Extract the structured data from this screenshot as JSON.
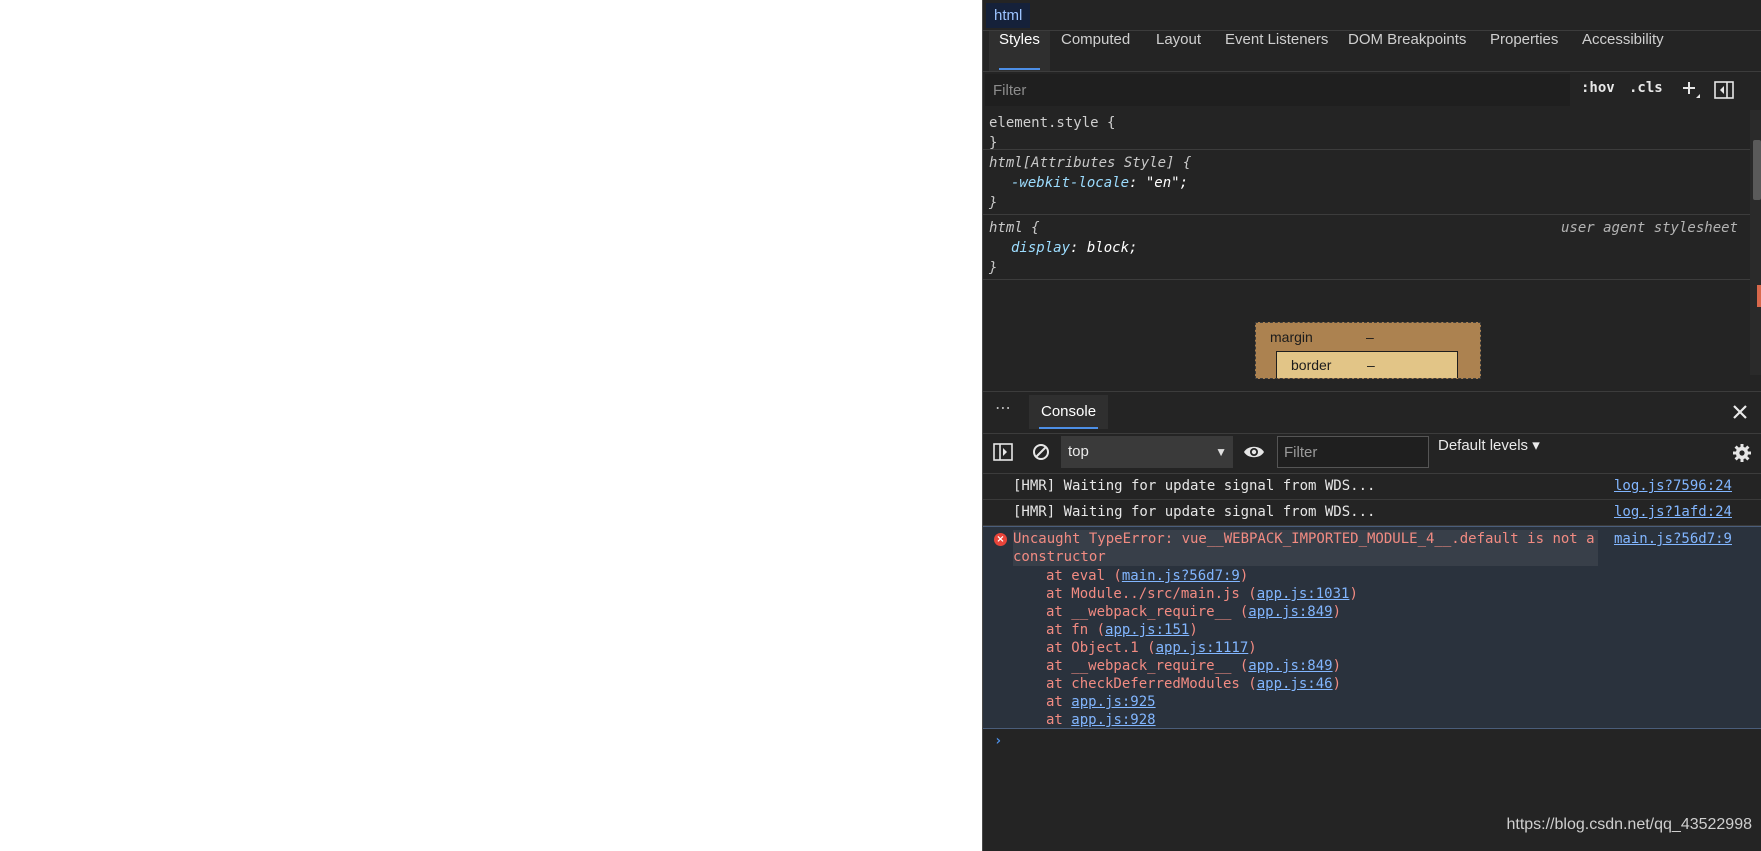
{
  "elements_panel": {
    "breadcrumb": "html",
    "tabs": [
      "Styles",
      "Computed",
      "Layout",
      "Event Listeners",
      "DOM Breakpoints",
      "Properties",
      "Accessibility"
    ],
    "filter_placeholder": "Filter",
    "hov_label": ":hov",
    "cls_label": ".cls",
    "rules": {
      "element_style": {
        "selector": "element.style {",
        "close": "}"
      },
      "attributes": {
        "selector": "html[Attributes Style] {",
        "prop": "-webkit-locale",
        "value": "\"en\"",
        "close": "}"
      },
      "ua": {
        "selector": "html {",
        "prop": "display",
        "value": "block",
        "close": "}",
        "origin": "user agent stylesheet"
      }
    },
    "box_model": {
      "margin_label": "margin",
      "margin_value": "–",
      "border_label": "border",
      "border_value": "–"
    }
  },
  "drawer": {
    "more_label": "⋮",
    "tab": "Console",
    "context": "top",
    "filter_placeholder": "Filter",
    "levels": "Default levels ▾"
  },
  "console": {
    "messages": [
      {
        "text": "[HMR] Waiting for update signal from WDS...",
        "source": "log.js?7596:24"
      },
      {
        "text": "[HMR] Waiting for update signal from WDS...",
        "source": "log.js?1afd:24"
      }
    ],
    "error": {
      "icon": "×",
      "message": "Uncaught TypeError: vue__WEBPACK_IMPORTED_MODULE_4__.default is not a constructor",
      "source": "main.js?56d7:9",
      "stack": [
        {
          "prefix": "at eval (",
          "link": "main.js?56d7:9",
          "suffix": ")"
        },
        {
          "prefix": "at Module../src/main.js (",
          "link": "app.js:1031",
          "suffix": ")"
        },
        {
          "prefix": "at __webpack_require__ (",
          "link": "app.js:849",
          "suffix": ")"
        },
        {
          "prefix": "at fn (",
          "link": "app.js:151",
          "suffix": ")"
        },
        {
          "prefix": "at Object.1 (",
          "link": "app.js:1117",
          "suffix": ")"
        },
        {
          "prefix": "at __webpack_require__ (",
          "link": "app.js:849",
          "suffix": ")"
        },
        {
          "prefix": "at checkDeferredModules (",
          "link": "app.js:46",
          "suffix": ")"
        },
        {
          "prefix": "at ",
          "link": "app.js:925",
          "suffix": ""
        },
        {
          "prefix": "at ",
          "link": "app.js:928",
          "suffix": ""
        }
      ]
    },
    "prompt": "›"
  },
  "watermark": "https://blog.csdn.net/qq_43522998",
  "colors": {
    "accent": "#4d8fe6",
    "error": "#f28b82",
    "link": "#82b6ff",
    "panel_bg": "#242424"
  }
}
